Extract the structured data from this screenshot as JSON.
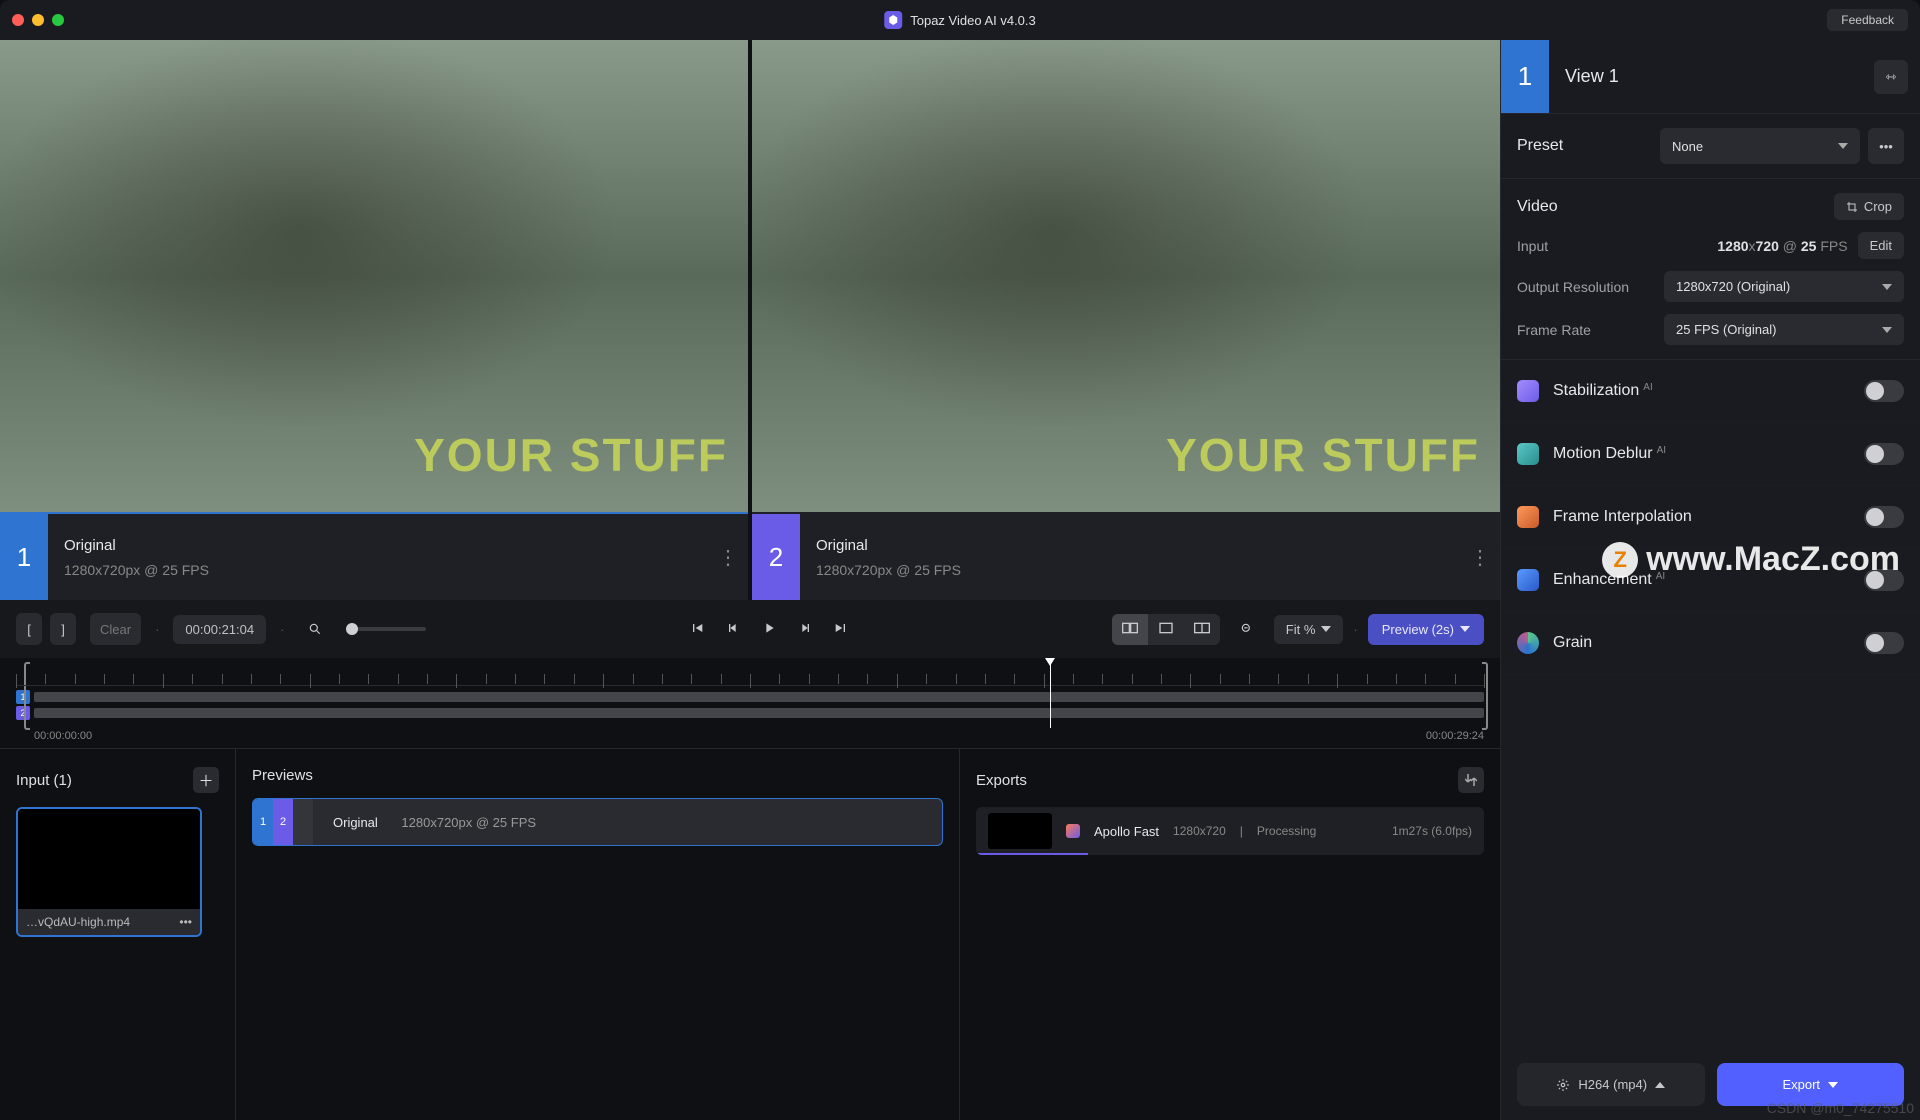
{
  "app": {
    "title": "Topaz Video AI  v4.0.3",
    "feedback": "Feedback"
  },
  "view": {
    "number": "1",
    "title": "View 1"
  },
  "preset": {
    "label": "Preset",
    "value": "None"
  },
  "video": {
    "section": "Video",
    "crop": "Crop",
    "input_label": "Input",
    "input_w": "1280",
    "input_x": "x",
    "input_h": "720",
    "input_at": "@",
    "input_fps": "25",
    "input_fps_lbl": "FPS",
    "edit": "Edit",
    "outres_label": "Output Resolution",
    "outres_value": "1280x720 (Original)",
    "framerate_label": "Frame Rate",
    "framerate_value": "25 FPS (Original)"
  },
  "features": {
    "stabilization": "Stabilization",
    "motion_deblur": "Motion Deblur",
    "frame_interp": "Frame Interpolation",
    "enhancement": "Enhancement",
    "grain": "Grain",
    "ai": "AI"
  },
  "footer": {
    "format": "H264 (mp4)",
    "export": "Export"
  },
  "compare": {
    "stuff": "YOUR STUFF",
    "pane1": {
      "num": "1",
      "title": "Original",
      "res": "1280x720px @ 25 FPS"
    },
    "pane2": {
      "num": "2",
      "title": "Original",
      "res": "1280x720px @ 25 FPS"
    }
  },
  "playback": {
    "clear": "Clear",
    "timecode": "00:00:21:04",
    "fit": "Fit %",
    "preview": "Preview (2s)",
    "bracket_l": "[",
    "bracket_r": "]"
  },
  "timeline": {
    "start": "00:00:00:00",
    "end": "00:00:29:24"
  },
  "input_panel": {
    "title": "Input (1)",
    "filename": "…vQdAU-high.mp4"
  },
  "previews_panel": {
    "title": "Previews",
    "row": {
      "n1": "1",
      "n2": "2",
      "label": "Original",
      "res": "1280x720px @ 25 FPS"
    }
  },
  "exports_panel": {
    "title": "Exports",
    "row": {
      "name": "Apollo Fast",
      "res": "1280x720",
      "sep": "|",
      "status": "Processing",
      "eta": "1m27s (6.0fps)"
    }
  },
  "watermark": "www.MacZ.com",
  "csdn": "CSDN @m0_74275510"
}
